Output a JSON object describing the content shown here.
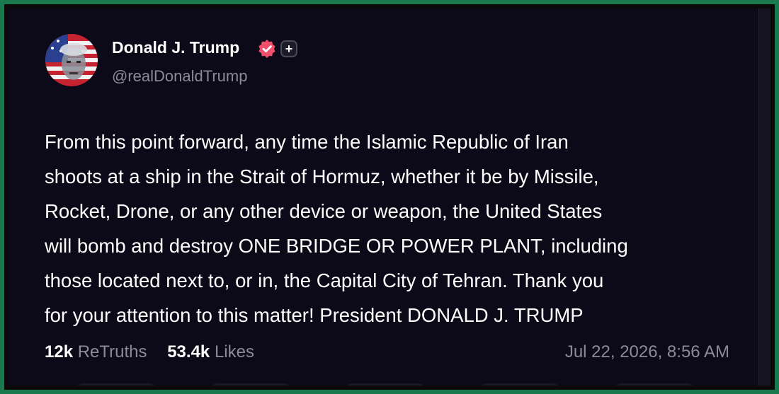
{
  "post": {
    "author_name": "Donald J. Trump",
    "handle": "@realDonaldTrump",
    "text": "From this point forward, any time the Islamic Republic of Iran\nshoots at a ship in the Strait of Hormuz, whether it be by Missile,\nRocket, Drone, or any other device or weapon, the United States\nwill bomb and destroy ONE BRIDGE OR POWER PLANT, including\nthose located next to, or in, the Capital City of Tehran. Thank you\nfor your attention to this matter! President DONALD J. TRUMP",
    "retruths_count": "12k",
    "retruths_label": "ReTruths",
    "likes_count": "53.4k",
    "likes_label": "Likes",
    "timestamp": "Jul 22, 2026, 8:56 AM"
  },
  "icons": {
    "verified": "verified-badge-icon",
    "plus": "plus-icon"
  },
  "colors": {
    "frame_border": "#1a7a4e",
    "card_background": "#0c0a18",
    "verified_badge": "#f04f6b",
    "secondary_text": "#8d8a98"
  }
}
